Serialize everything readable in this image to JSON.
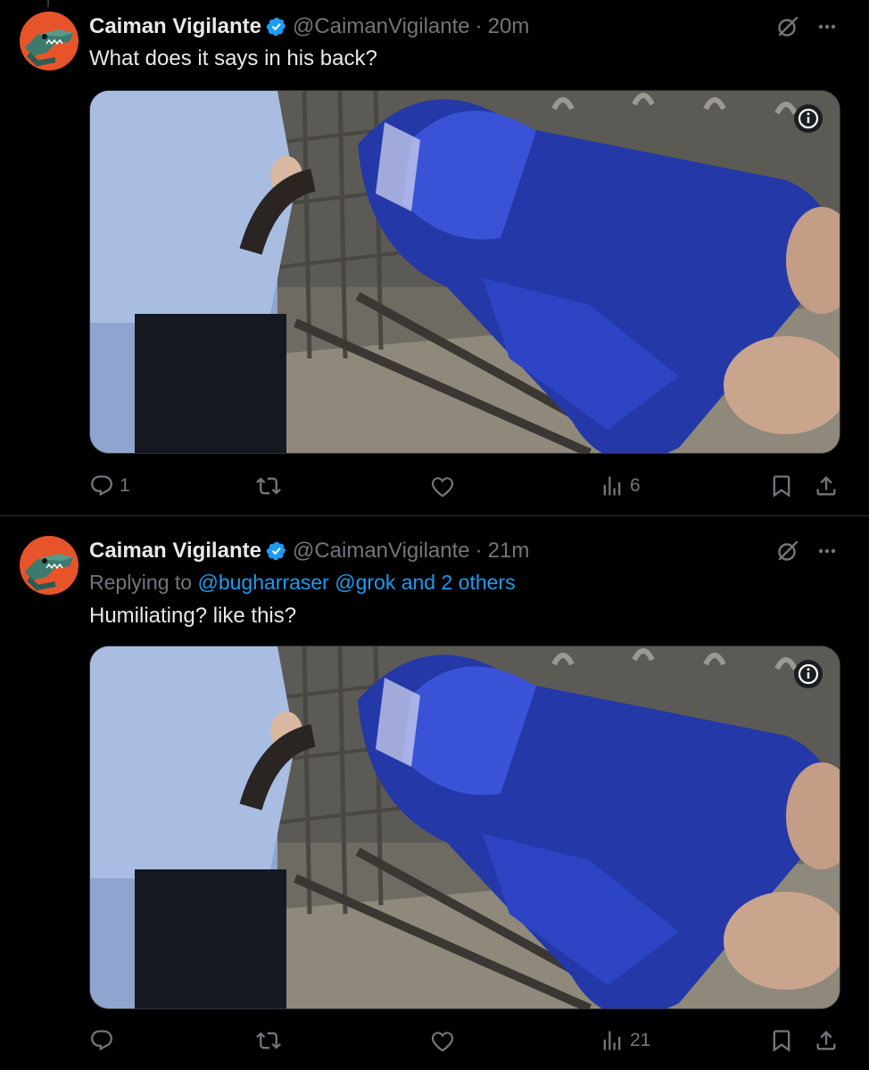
{
  "tweets": [
    {
      "author": "Caiman Vigilante",
      "handle": "@CaimanVigilante",
      "separator": "·",
      "time": "20m",
      "reply_prefix": "",
      "reply_handles": "",
      "text": "What does it says in his back?",
      "stats": {
        "replies": "1",
        "reposts": "",
        "likes": "",
        "views": "6"
      }
    },
    {
      "author": "Caiman Vigilante",
      "handle": "@CaimanVigilante",
      "separator": "·",
      "time": "21m",
      "reply_prefix": "Replying to ",
      "reply_handles": "@bugharraser @grok and 2 others",
      "text": "Humiliating? like this?",
      "stats": {
        "replies": "",
        "reposts": "",
        "likes": "",
        "views": "21"
      }
    }
  ],
  "icons": [
    "avatar-crocodile",
    "verified-badge-icon",
    "grok-icon",
    "more-icon",
    "info-icon",
    "reply-icon",
    "repost-icon",
    "like-icon",
    "views-icon",
    "bookmark-icon",
    "share-icon"
  ],
  "colors": {
    "background": "#000000",
    "text": "#e7e9ea",
    "muted": "#71767b",
    "link": "#1d9bf0",
    "divider": "#2f3336",
    "avatar_bg": "#e8542a"
  }
}
